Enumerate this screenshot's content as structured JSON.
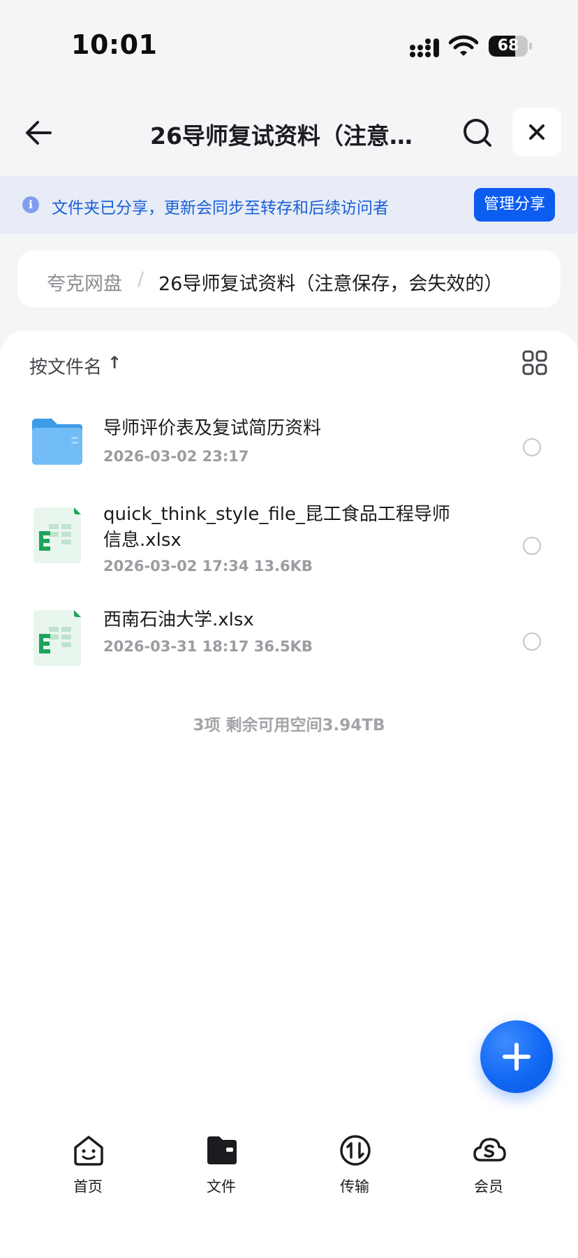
{
  "status_bar": {
    "time": "10:01",
    "battery_level": "68",
    "battery_fraction": 0.68,
    "icons": [
      "cellular-signal-icon",
      "wifi-icon",
      "battery-icon"
    ]
  },
  "nav": {
    "title": "26导师复试资料（注意…",
    "icons": [
      "back-arrow-icon",
      "search-icon",
      "close-icon"
    ]
  },
  "banner": {
    "text": "文件夹已分享，更新会同步至转存和后续访问者",
    "button_label": "管理分享",
    "icon": "info-icon",
    "info_glyph": "i"
  },
  "breadcrumb": {
    "root": "夸克网盘",
    "separator": "/",
    "current": "26导师复试资料（注意保存，会失效的）"
  },
  "toolbar": {
    "sort_label": "按文件名",
    "sort_arrow": "↑",
    "view_icon": "grid-view-icon"
  },
  "files": [
    {
      "type": "folder",
      "icon": "folder-icon",
      "name": "导师评价表及复试简历资料",
      "meta": "2026-03-02 23:17"
    },
    {
      "type": "xlsx",
      "icon": "excel-file-icon",
      "name": "quick_think_style_file_昆工食品工程导师信息.xlsx",
      "meta": "2026-03-02 17:34  13.6KB"
    },
    {
      "type": "xlsx",
      "icon": "excel-file-icon",
      "name": "西南石油大学.xlsx",
      "meta": "2026-03-31 18:17  36.5KB"
    }
  ],
  "summary": "3项 剩余可用空间3.94TB",
  "fab": {
    "icon": "plus-icon"
  },
  "tabs": [
    {
      "label": "首页",
      "icon": "home-face-icon"
    },
    {
      "label": "文件",
      "icon": "folder-icon"
    },
    {
      "label": "传输",
      "icon": "transfer-icon"
    },
    {
      "label": "会员",
      "icon": "cloud-membership-icon"
    }
  ],
  "colors": {
    "accent": "#0c5cf0",
    "banner_bg": "#e7ecf6",
    "banner_text": "#1a5fd6",
    "excel_green": "#1ea35b",
    "folder_blue": "#4fa7ec"
  }
}
